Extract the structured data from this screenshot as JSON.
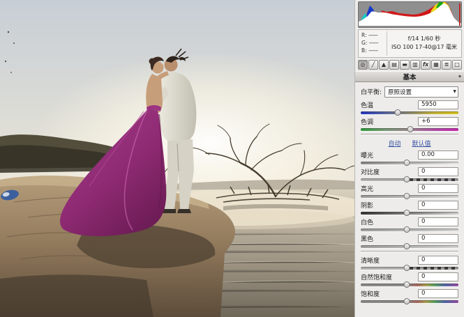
{
  "histogram_panel": {
    "rgb": [
      {
        "label": "R:",
        "value": "——"
      },
      {
        "label": "G:",
        "value": "——"
      },
      {
        "label": "B:",
        "value": "——"
      }
    ],
    "exif_line1": "f/14   1/60 秒",
    "exif_line2": "ISO 100   17-40@17 毫米"
  },
  "tabs": [
    {
      "name": "basic",
      "glyph": "◎"
    },
    {
      "name": "tone-curve",
      "glyph": "╱"
    },
    {
      "name": "detail",
      "glyph": "▲"
    },
    {
      "name": "hsl-grayscale",
      "glyph": "▤"
    },
    {
      "name": "split-toning",
      "glyph": "▬"
    },
    {
      "name": "lens-corrections",
      "glyph": "▥"
    },
    {
      "name": "effects",
      "glyph": "fx"
    },
    {
      "name": "camera-calibration",
      "glyph": "▦"
    },
    {
      "name": "presets",
      "glyph": "≣"
    },
    {
      "name": "snapshots",
      "glyph": "□"
    }
  ],
  "section": {
    "title": "基本",
    "corner_glyph": "▪"
  },
  "white_balance": {
    "label": "白平衡:",
    "selected": "原照设置",
    "dropdown_icon": "▼"
  },
  "temperature": {
    "label": "色温",
    "value": "5950",
    "thumb_pct": 38
  },
  "tint": {
    "label": "色调",
    "value": "+6",
    "thumb_pct": 51
  },
  "links": {
    "auto": "自动",
    "default": "默认值"
  },
  "sliders": [
    {
      "label": "曝光",
      "value": "0.00",
      "thumb_pct": 47
    },
    {
      "label": "对比度",
      "value": "0",
      "thumb_pct": 47
    },
    {
      "label": "高光",
      "value": "0",
      "thumb_pct": 47
    },
    {
      "label": "阴影",
      "value": "0",
      "thumb_pct": 47
    },
    {
      "label": "白色",
      "value": "0",
      "thumb_pct": 47
    },
    {
      "label": "黑色",
      "value": "0",
      "thumb_pct": 47
    },
    {
      "label": "清晰度",
      "value": "0",
      "thumb_pct": 47
    },
    {
      "label": "自然饱和度",
      "value": "0",
      "thumb_pct": 47
    },
    {
      "label": "饱和度",
      "value": "0",
      "thumb_pct": 47
    }
  ],
  "colors": {
    "dress": "#8e2a72",
    "suit": "#dad7cc",
    "histogram_red": "#d01818",
    "histogram_yellow": "#e8d818",
    "histogram_blue": "#1838c8",
    "histogram_cyan": "#18c8c8",
    "link_blue": "#3a54a2"
  }
}
